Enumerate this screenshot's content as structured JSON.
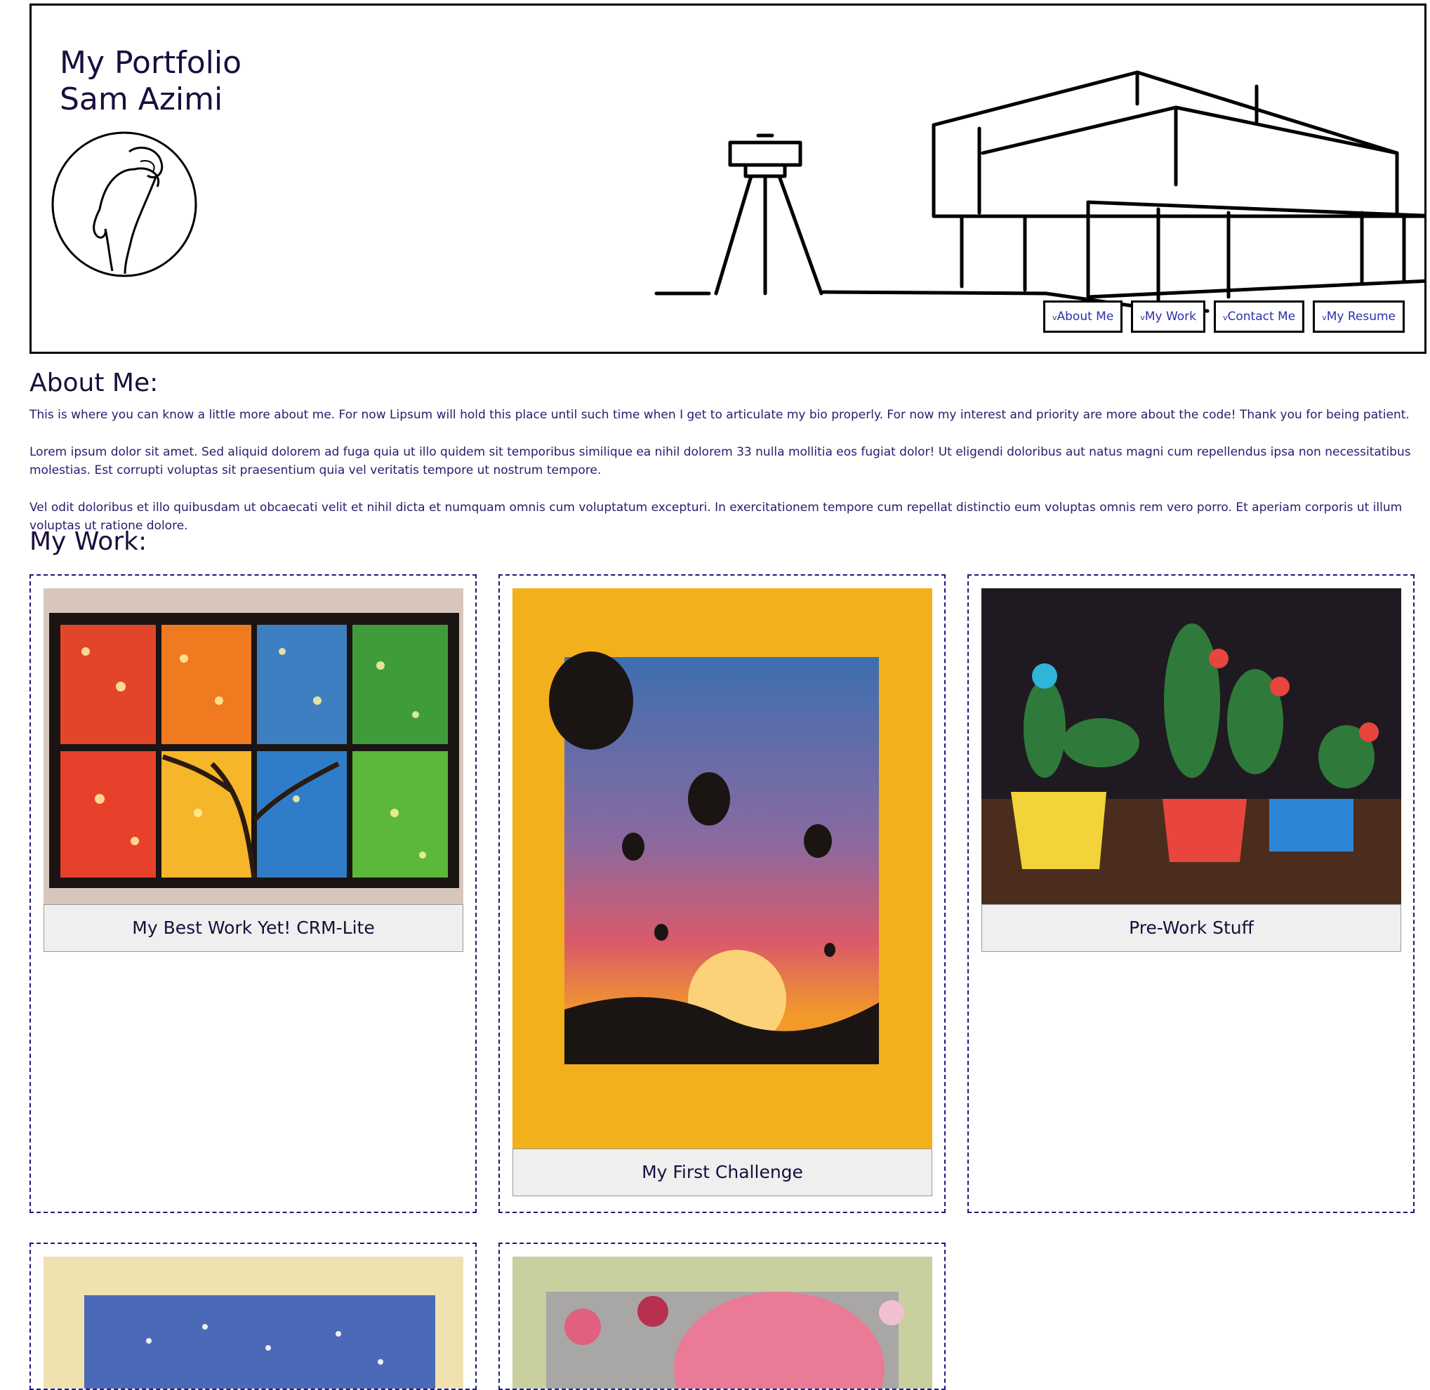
{
  "header": {
    "title_line1": "My Portfolio",
    "title_line2": "Sam Azimi",
    "nav": [
      {
        "chevron": "v",
        "label": "About Me"
      },
      {
        "chevron": "v",
        "label": "My Work"
      },
      {
        "chevron": "v",
        "label": "Contact Me"
      },
      {
        "chevron": "v",
        "label": "My Resume"
      }
    ]
  },
  "about": {
    "heading": "About Me:",
    "paragraphs": [
      "This is where you can know a little more about me. For now Lipsum will hold this place until such time when I get to articulate my bio properly. For now my interest and priority are more about the code! Thank you for being patient.",
      "Lorem ipsum dolor sit amet. Sed aliquid dolorem ad fuga quia ut illo quidem sit temporibus similique ea nihil dolorem 33 nulla mollitia eos fugiat dolor! Ut eligendi doloribus aut natus magni cum repellendus ipsa non necessitatibus molestias. Est corrupti voluptas sit praesentium quia vel veritatis tempore ut nostrum tempore.",
      "Vel odit doloribus et illo quibusdam ut obcaecati velit et nihil dicta et numquam omnis cum voluptatum excepturi. In exercitationem tempore cum repellat distinctio eum voluptas omnis rem vero porro. Et aperiam corporis ut illum voluptas ut ratione dolore."
    ]
  },
  "work": {
    "heading": "My Work:",
    "projects": [
      {
        "caption": "My Best Work Yet! CRM-Lite",
        "image": "four-seasons-tree-painting"
      },
      {
        "caption": "My First Challenge",
        "image": "hot-air-balloons-sunset-painting"
      },
      {
        "caption": "Pre-Work Stuff",
        "image": "cactus-pots-painting"
      },
      {
        "caption": "",
        "image": "aurora-night-painting"
      },
      {
        "caption": "",
        "image": "pink-flamingo-painting"
      }
    ]
  },
  "colors": {
    "text": "#1b0d3d",
    "link": "#2f2fa8",
    "card_border": "#1a1a80",
    "caption_bg": "#efefef"
  }
}
